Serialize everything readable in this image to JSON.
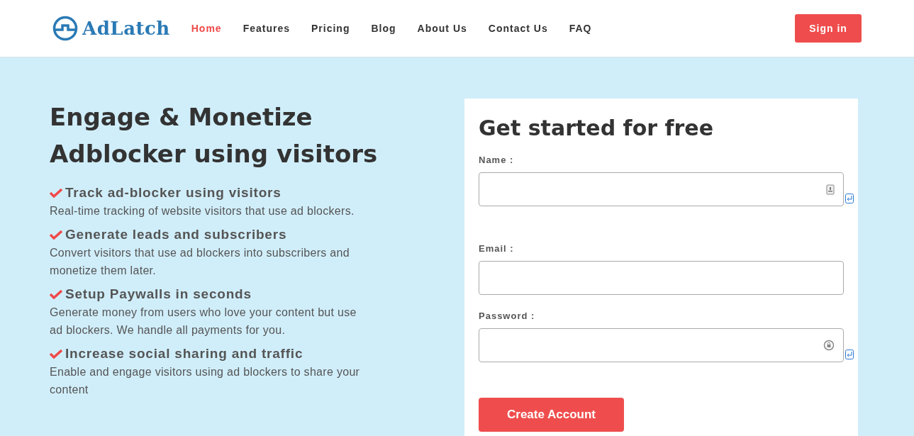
{
  "brand": {
    "name": "AdLatch"
  },
  "nav": [
    {
      "label": "Home",
      "selected": true
    },
    {
      "label": "Features",
      "selected": false
    },
    {
      "label": "Pricing",
      "selected": false
    },
    {
      "label": "Blog",
      "selected": false
    },
    {
      "label": "About Us",
      "selected": false
    },
    {
      "label": "Contact Us",
      "selected": false
    },
    {
      "label": "FAQ",
      "selected": false
    }
  ],
  "sign_in": "Sign in",
  "hero": {
    "title": "Engage & Monetize Adblocker using visitors",
    "features": [
      {
        "title": "Track ad-blocker using visitors",
        "text": "Real-time tracking of website visitors that use ad blockers."
      },
      {
        "title": "Generate leads and subscribers",
        "text": "Convert visitors that use ad blockers into subscribers and monetize them later."
      },
      {
        "title": "Setup Paywalls in seconds",
        "text": "Generate money from users who love your content but use ad blockers. We handle all payments for you."
      },
      {
        "title": "Increase social sharing and traffic",
        "text": "Enable and engage visitors using ad blockers to share your content"
      }
    ]
  },
  "form": {
    "title": "Get started for free",
    "fields": [
      {
        "label": "Name :",
        "kind": "contact"
      },
      {
        "label": "Email :",
        "kind": "plain"
      },
      {
        "label": "Password :",
        "kind": "lock"
      }
    ],
    "submit": "Create Account"
  }
}
